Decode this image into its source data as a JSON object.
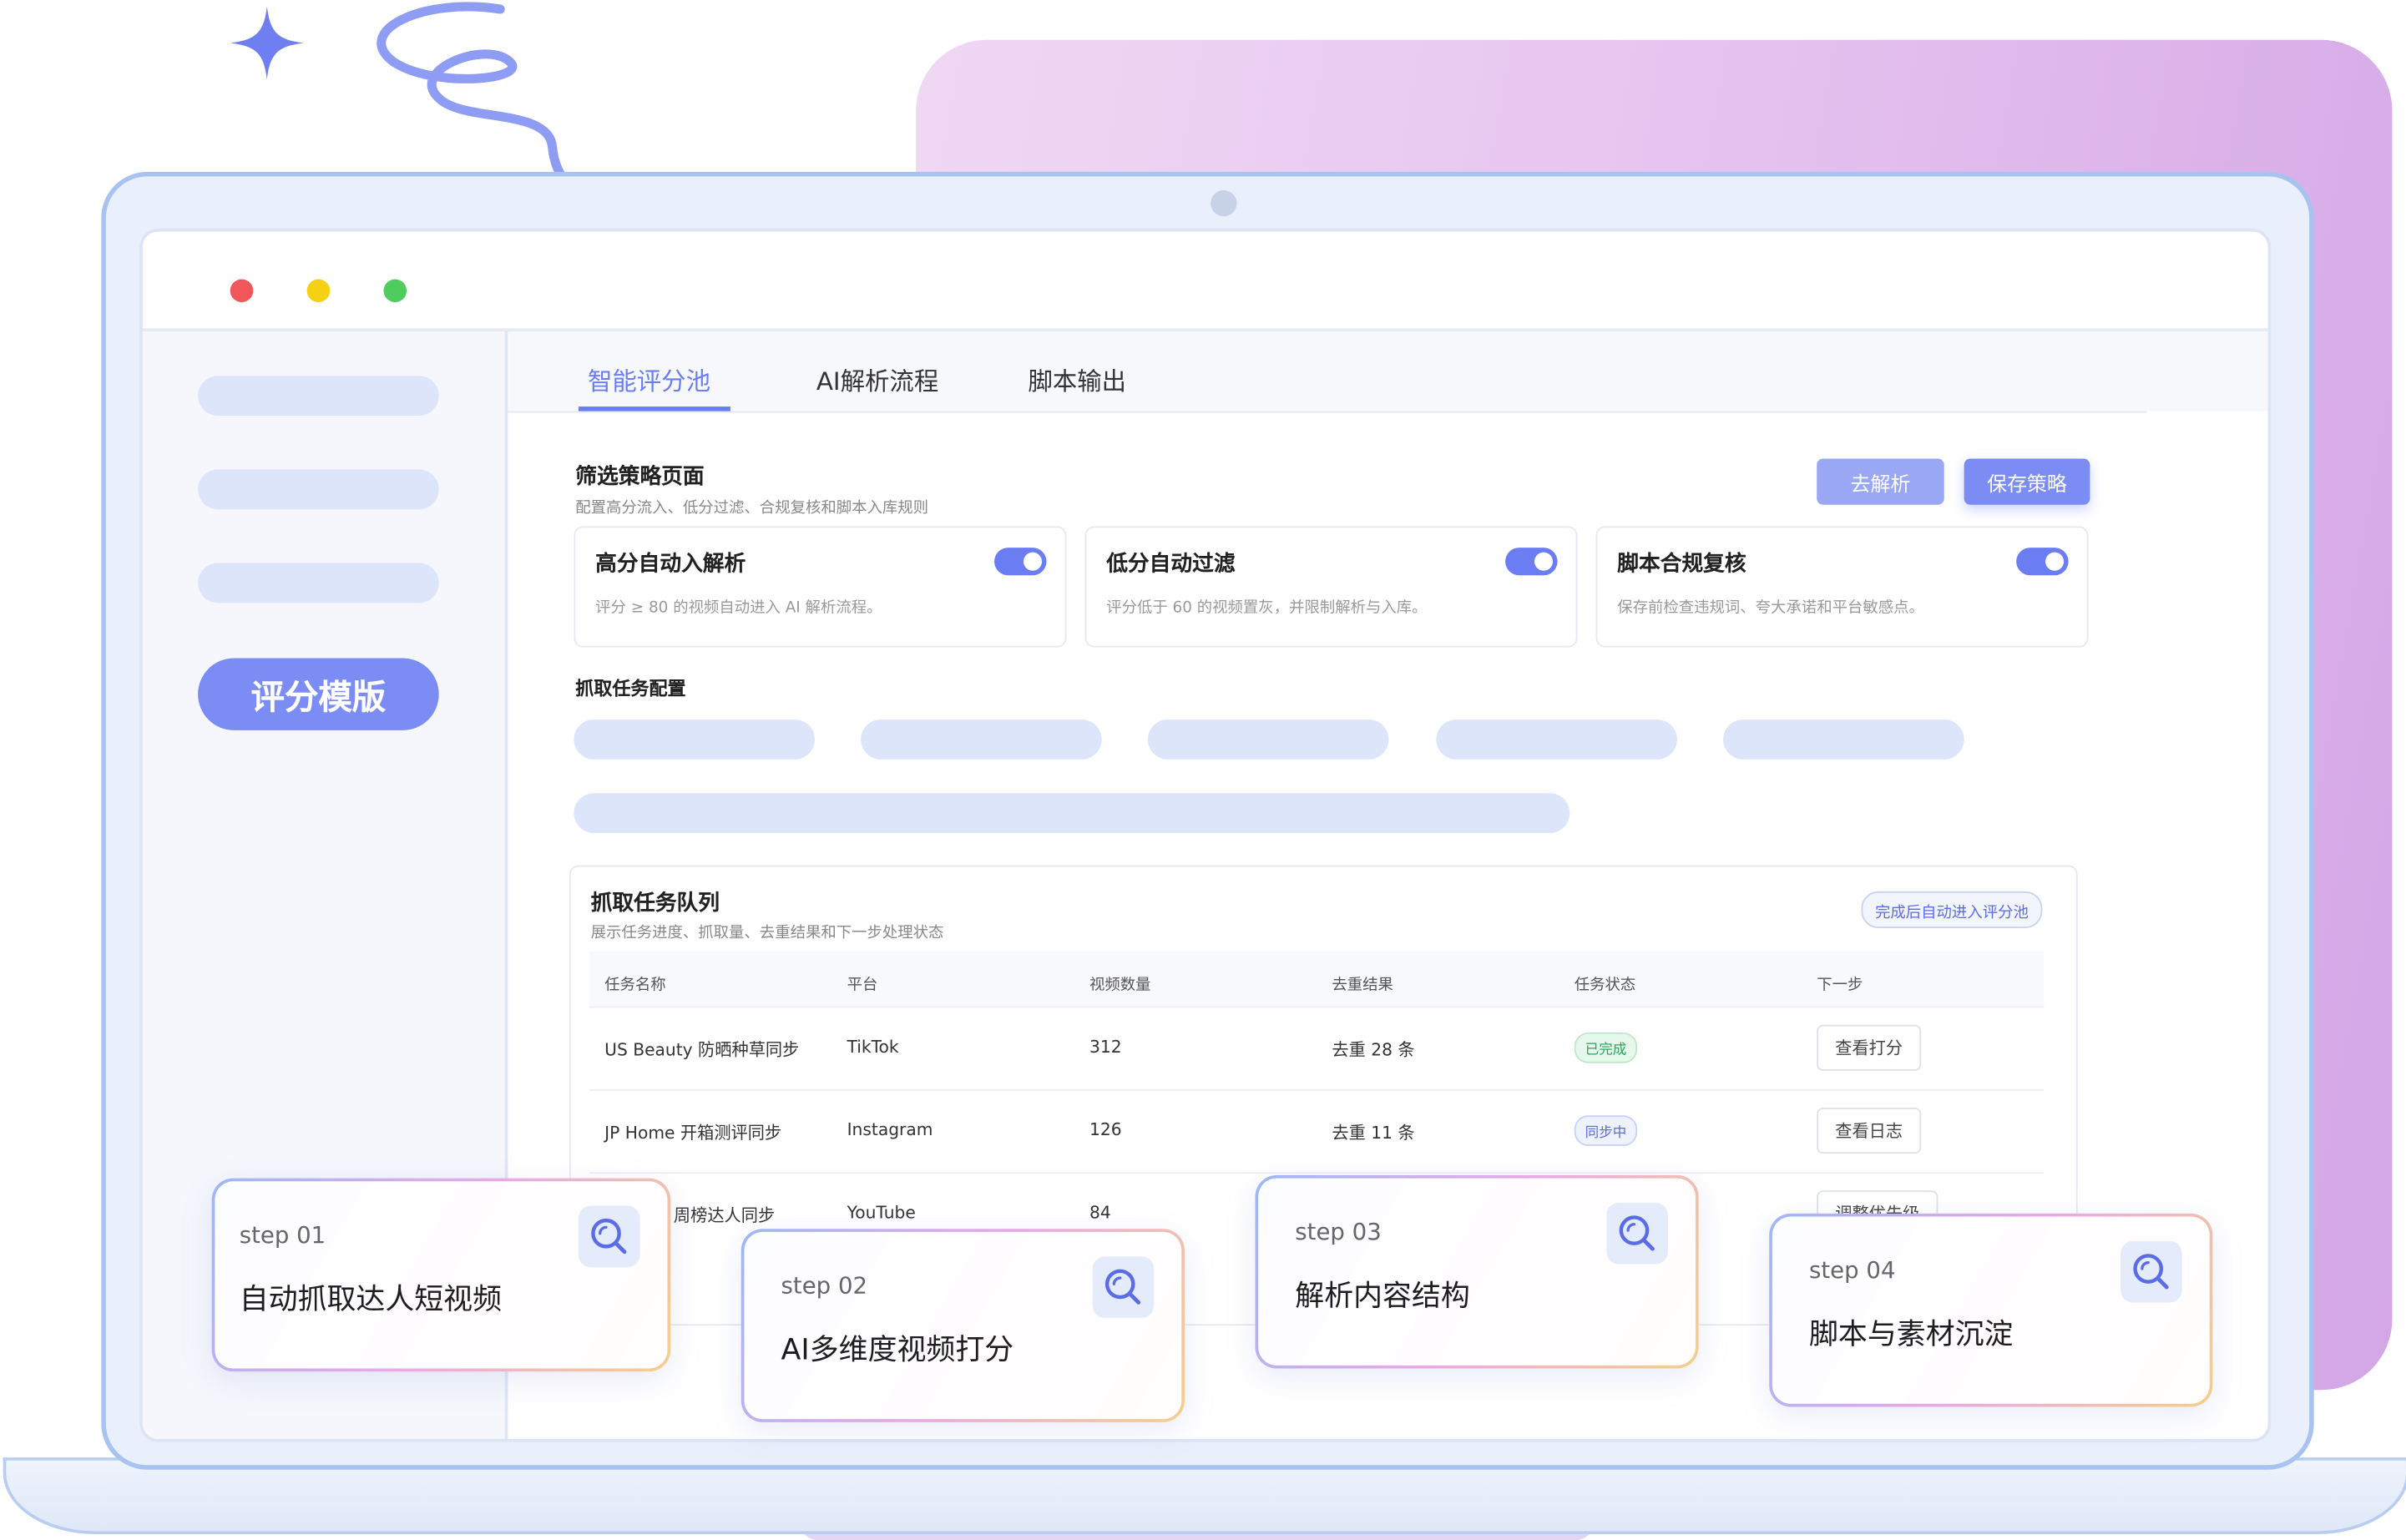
{
  "tabs": [
    {
      "label": "智能评分池",
      "active": true
    },
    {
      "label": "AI解析流程",
      "active": false
    },
    {
      "label": "脚本输出",
      "active": false
    }
  ],
  "sidebar": {
    "active_label": "评分模版"
  },
  "strategy": {
    "title": "筛选策略页面",
    "subtitle": "配置高分流入、低分过滤、合规复核和脚本入库规则",
    "btn_parse": "去解析",
    "btn_save": "保存策略",
    "cards": [
      {
        "title": "高分自动入解析",
        "desc": "评分 ≥ 80 的视频自动进入 AI 解析流程。",
        "enabled": true
      },
      {
        "title": "低分自动过滤",
        "desc": "评分低于 60 的视频置灰，并限制解析与入库。",
        "enabled": true
      },
      {
        "title": "脚本合规复核",
        "desc": "保存前检查违规词、夸大承诺和平台敏感点。",
        "enabled": true
      }
    ]
  },
  "crawl_config": {
    "title": "抓取任务配置"
  },
  "queue": {
    "title": "抓取任务队列",
    "subtitle": "展示任务进度、抓取量、去重结果和下一步处理状态",
    "badge": "完成后自动进入评分池",
    "columns": [
      "任务名称",
      "平台",
      "视频数量",
      "去重结果",
      "任务状态",
      "下一步"
    ],
    "rows": [
      {
        "name": "US Beauty 防晒种草同步",
        "platform": "TikTok",
        "count": "312",
        "dedup": "去重 28 条",
        "status": "已完成",
        "status_type": "done",
        "action": "查看打分"
      },
      {
        "name": "JP Home 开箱测评同步",
        "platform": "Instagram",
        "count": "126",
        "dedup": "去重 11 条",
        "status": "同步中",
        "status_type": "sync",
        "action": "查看日志"
      },
      {
        "name": "周榜达人同步",
        "platform": "YouTube",
        "count": "84",
        "dedup": "",
        "status": "",
        "status_type": "",
        "action": "调整优先级"
      }
    ]
  },
  "steps": [
    {
      "num": "step 01",
      "title": "自动抓取达人短视频"
    },
    {
      "num": "step 02",
      "title": "AI多维度视频打分"
    },
    {
      "num": "step 03",
      "title": "解析内容结构"
    },
    {
      "num": "step 04",
      "title": "脚本与素材沉淀"
    }
  ],
  "colors": {
    "accent": "#6b7df2",
    "window_close": "#f0565a",
    "window_min": "#f6d012",
    "window_max": "#4fcc5e"
  }
}
